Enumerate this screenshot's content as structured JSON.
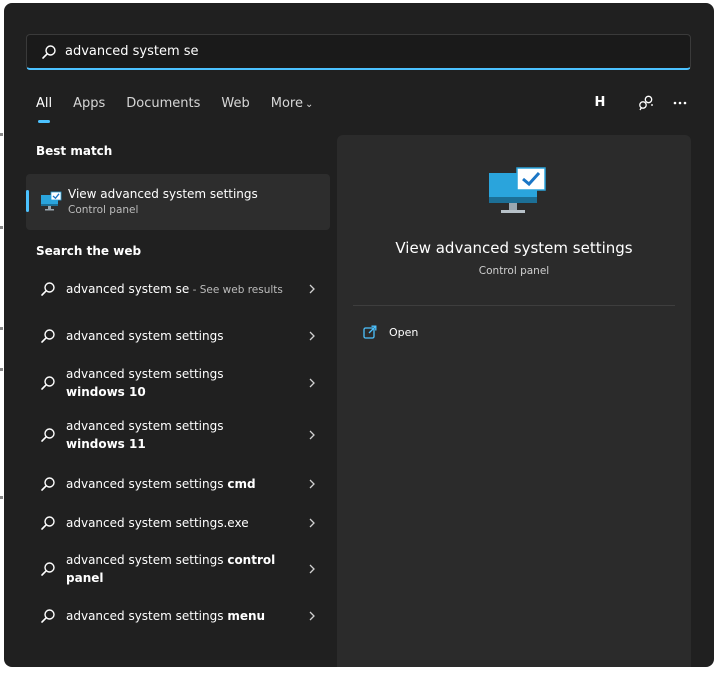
{
  "search": {
    "value": "advanced system se",
    "icon": "search-icon",
    "accent": "#4cc2ff"
  },
  "tabs": [
    {
      "label": "All",
      "active": true
    },
    {
      "label": "Apps"
    },
    {
      "label": "Documents"
    },
    {
      "label": "Web"
    },
    {
      "label": "More"
    }
  ],
  "toolbar": {
    "avatar_initial": "H",
    "icons": [
      "share-icon",
      "more-options-icon"
    ]
  },
  "best_match": {
    "heading": "Best match",
    "title": "View advanced system settings",
    "subtitle": "Control panel",
    "icon": "monitor-check-icon"
  },
  "web": {
    "heading": "Search the web",
    "items": [
      {
        "text": "advanced system se",
        "suffix": " - See web results"
      },
      {
        "text": "advanced system settings"
      },
      {
        "text": "advanced system settings",
        "bold": "windows 10"
      },
      {
        "text": "advanced system settings",
        "bold": "windows 11"
      },
      {
        "text": "advanced system settings",
        "bold": "cmd"
      },
      {
        "text": "advanced system settings.exe"
      },
      {
        "text": "advanced system settings",
        "bold": "control panel"
      },
      {
        "text": "advanced system settings",
        "bold": "menu"
      }
    ]
  },
  "preview": {
    "title": "View advanced system settings",
    "subtitle": "Control panel",
    "action_label": "Open",
    "action_icon": "open-external-icon"
  },
  "colors": {
    "background": "#202020",
    "card": "#2b2b2b",
    "selected": "#2d2d2d",
    "accent": "#4cc2ff"
  }
}
